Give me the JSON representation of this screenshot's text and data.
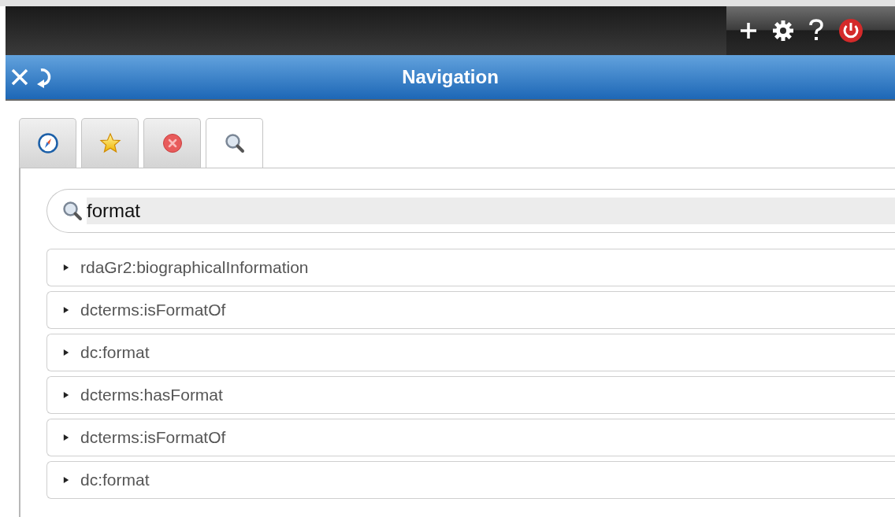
{
  "header": {
    "title": "Navigation"
  },
  "tabs": [
    {
      "selected": false
    },
    {
      "selected": false
    },
    {
      "selected": false
    },
    {
      "selected": true
    }
  ],
  "search": {
    "value": "format"
  },
  "results": [
    {
      "label": "rdaGr2:biographicalInformation",
      "expanded": false
    },
    {
      "label": "dcterms:isFormatOf",
      "expanded": false
    },
    {
      "label": "dc:format",
      "expanded": false
    },
    {
      "label": "dcterms:hasFormat",
      "expanded": false
    },
    {
      "label": "dcterms:isFormatOf",
      "expanded": false
    },
    {
      "label": "dc:format",
      "expanded": false
    }
  ]
}
